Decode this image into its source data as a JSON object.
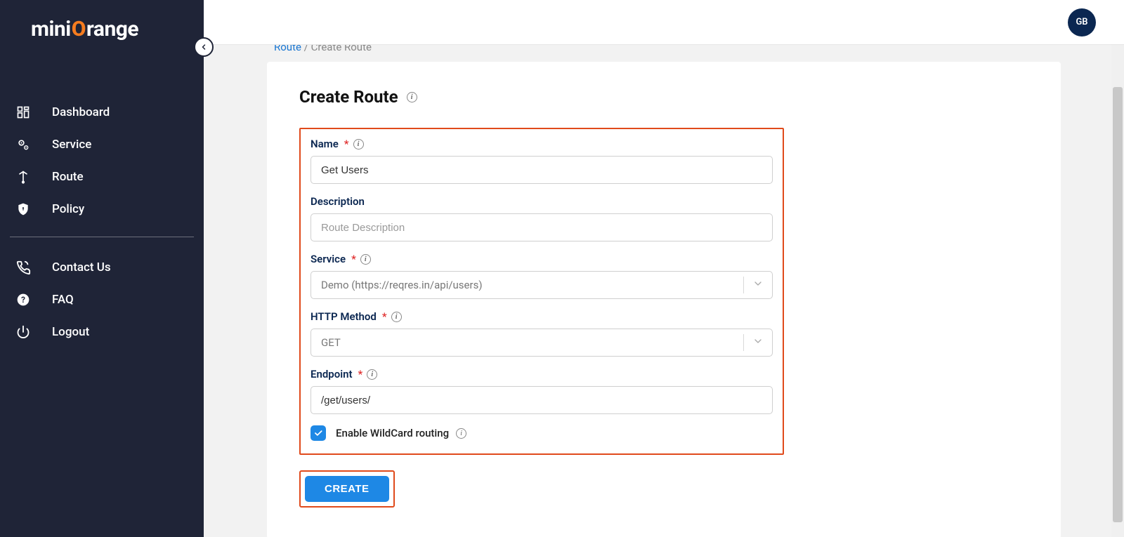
{
  "brand": {
    "text1": "mini",
    "textO": "O",
    "text2": "range"
  },
  "avatarInitials": "GB",
  "sidebar": {
    "items": [
      {
        "label": "Dashboard"
      },
      {
        "label": "Service"
      },
      {
        "label": "Route"
      },
      {
        "label": "Policy"
      }
    ],
    "secondaryItems": [
      {
        "label": "Contact Us"
      },
      {
        "label": "FAQ"
      },
      {
        "label": "Logout"
      }
    ]
  },
  "breadcrumb": {
    "root": "Route",
    "separator": "/",
    "current": "Create Route"
  },
  "page": {
    "title": "Create Route"
  },
  "form": {
    "name": {
      "label": "Name",
      "value": "Get Users"
    },
    "description": {
      "label": "Description",
      "placeholder": "Route Description",
      "value": ""
    },
    "service": {
      "label": "Service",
      "selected": "Demo (https://reqres.in/api/users)"
    },
    "method": {
      "label": "HTTP Method",
      "selected": "GET"
    },
    "endpoint": {
      "label": "Endpoint",
      "value": "/get/users/"
    },
    "wildcard": {
      "label": "Enable WildCard routing",
      "checked": true
    }
  },
  "buttons": {
    "create": "CREATE"
  }
}
